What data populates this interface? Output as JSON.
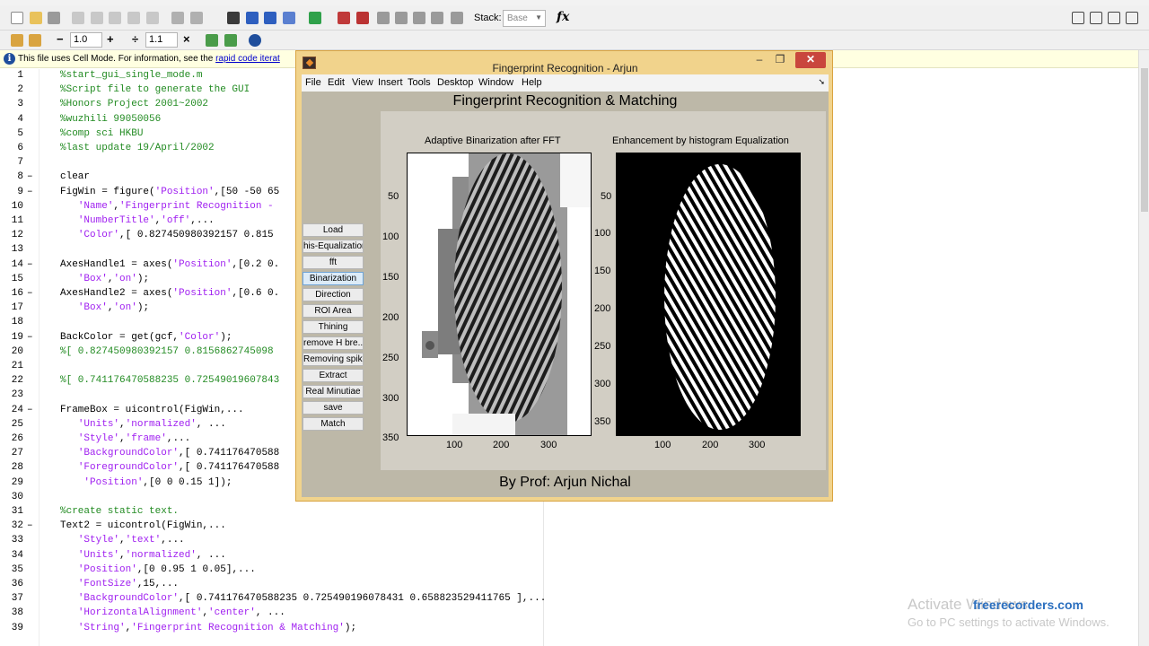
{
  "toolbar": {
    "stack_label": "Stack:",
    "stack_value": "Base",
    "fx_label": "fx"
  },
  "toolbar2": {
    "minus": "−",
    "field1": "1.0",
    "plus": "+",
    "divide": "÷",
    "field2": "1.1",
    "times": "×"
  },
  "infobar": {
    "text_before": "This file uses Cell Mode. For information, see the ",
    "link_text": "rapid code iterat"
  },
  "editor": {
    "lines": [
      {
        "n": "1",
        "fold": "",
        "code": [
          {
            "t": "%start_gui_single_mode.m",
            "c": "cm"
          }
        ]
      },
      {
        "n": "2",
        "fold": "",
        "code": [
          {
            "t": "%Script file to generate the GUI",
            "c": "cm"
          }
        ]
      },
      {
        "n": "3",
        "fold": "",
        "code": [
          {
            "t": "%Honors Project 2001~2002",
            "c": "cm"
          }
        ]
      },
      {
        "n": "4",
        "fold": "",
        "code": [
          {
            "t": "%wuzhili 99050056",
            "c": "cm"
          }
        ]
      },
      {
        "n": "5",
        "fold": "",
        "code": [
          {
            "t": "%comp sci HKBU",
            "c": "cm"
          }
        ]
      },
      {
        "n": "6",
        "fold": "",
        "code": [
          {
            "t": "%last update 19/April/2002",
            "c": "cm"
          }
        ]
      },
      {
        "n": "7",
        "fold": "",
        "code": []
      },
      {
        "n": "8",
        "fold": "–",
        "code": [
          {
            "t": "clear",
            "c": "txt"
          }
        ]
      },
      {
        "n": "9",
        "fold": "–",
        "code": [
          {
            "t": "FigWin = figure(",
            "c": "txt"
          },
          {
            "t": "'Position'",
            "c": "str"
          },
          {
            "t": ",[50 -50 65",
            "c": "txt"
          }
        ]
      },
      {
        "n": "10",
        "fold": "",
        "code": [
          {
            "t": "   ",
            "c": "txt"
          },
          {
            "t": "'Name'",
            "c": "str"
          },
          {
            "t": ",",
            "c": "txt"
          },
          {
            "t": "'Fingerprint Recognition -",
            "c": "str"
          }
        ]
      },
      {
        "n": "11",
        "fold": "",
        "code": [
          {
            "t": "   ",
            "c": "txt"
          },
          {
            "t": "'NumberTitle'",
            "c": "str"
          },
          {
            "t": ",",
            "c": "txt"
          },
          {
            "t": "'off'",
            "c": "str"
          },
          {
            "t": ",...",
            "c": "txt"
          }
        ]
      },
      {
        "n": "12",
        "fold": "",
        "code": [
          {
            "t": "   ",
            "c": "txt"
          },
          {
            "t": "'Color'",
            "c": "str"
          },
          {
            "t": ",[ 0.827450980392157 0.815",
            "c": "txt"
          }
        ]
      },
      {
        "n": "13",
        "fold": "",
        "code": []
      },
      {
        "n": "14",
        "fold": "–",
        "code": [
          {
            "t": "AxesHandle1 = axes(",
            "c": "txt"
          },
          {
            "t": "'Position'",
            "c": "str"
          },
          {
            "t": ",[0.2 0.",
            "c": "txt"
          }
        ]
      },
      {
        "n": "15",
        "fold": "",
        "code": [
          {
            "t": "   ",
            "c": "txt"
          },
          {
            "t": "'Box'",
            "c": "str"
          },
          {
            "t": ",",
            "c": "txt"
          },
          {
            "t": "'on'",
            "c": "str"
          },
          {
            "t": ");",
            "c": "txt"
          }
        ]
      },
      {
        "n": "16",
        "fold": "–",
        "code": [
          {
            "t": "AxesHandle2 = axes(",
            "c": "txt"
          },
          {
            "t": "'Position'",
            "c": "str"
          },
          {
            "t": ",[0.6 0.",
            "c": "txt"
          }
        ]
      },
      {
        "n": "17",
        "fold": "",
        "code": [
          {
            "t": "   ",
            "c": "txt"
          },
          {
            "t": "'Box'",
            "c": "str"
          },
          {
            "t": ",",
            "c": "txt"
          },
          {
            "t": "'on'",
            "c": "str"
          },
          {
            "t": ");",
            "c": "txt"
          }
        ]
      },
      {
        "n": "18",
        "fold": "",
        "code": []
      },
      {
        "n": "19",
        "fold": "–",
        "code": [
          {
            "t": "BackColor = get(gcf,",
            "c": "txt"
          },
          {
            "t": "'Color'",
            "c": "str"
          },
          {
            "t": ");",
            "c": "txt"
          }
        ]
      },
      {
        "n": "20",
        "fold": "",
        "code": [
          {
            "t": "%[ 0.827450980392157 0.8156862745098",
            "c": "cm"
          }
        ]
      },
      {
        "n": "21",
        "fold": "",
        "code": []
      },
      {
        "n": "22",
        "fold": "",
        "code": [
          {
            "t": "%[ 0.741176470588235 0.72549019607843",
            "c": "cm"
          }
        ]
      },
      {
        "n": "23",
        "fold": "",
        "code": []
      },
      {
        "n": "24",
        "fold": "–",
        "code": [
          {
            "t": "FrameBox = uicontrol(FigWin,...",
            "c": "txt"
          }
        ]
      },
      {
        "n": "25",
        "fold": "",
        "code": [
          {
            "t": "   ",
            "c": "txt"
          },
          {
            "t": "'Units'",
            "c": "str"
          },
          {
            "t": ",",
            "c": "txt"
          },
          {
            "t": "'normalized'",
            "c": "str"
          },
          {
            "t": ", ...",
            "c": "txt"
          }
        ]
      },
      {
        "n": "26",
        "fold": "",
        "code": [
          {
            "t": "   ",
            "c": "txt"
          },
          {
            "t": "'Style'",
            "c": "str"
          },
          {
            "t": ",",
            "c": "txt"
          },
          {
            "t": "'frame'",
            "c": "str"
          },
          {
            "t": ",...",
            "c": "txt"
          }
        ]
      },
      {
        "n": "27",
        "fold": "",
        "code": [
          {
            "t": "   ",
            "c": "txt"
          },
          {
            "t": "'BackgroundColor'",
            "c": "str"
          },
          {
            "t": ",[ 0.741176470588",
            "c": "txt"
          }
        ]
      },
      {
        "n": "28",
        "fold": "",
        "code": [
          {
            "t": "   ",
            "c": "txt"
          },
          {
            "t": "'ForegroundColor'",
            "c": "str"
          },
          {
            "t": ",[ 0.741176470588",
            "c": "txt"
          }
        ]
      },
      {
        "n": "29",
        "fold": "",
        "code": [
          {
            "t": "    ",
            "c": "txt"
          },
          {
            "t": "'Position'",
            "c": "str"
          },
          {
            "t": ",[0 0 0.15 1]);",
            "c": "txt"
          }
        ]
      },
      {
        "n": "30",
        "fold": "",
        "code": []
      },
      {
        "n": "31",
        "fold": "",
        "code": [
          {
            "t": "%create static text.",
            "c": "cm"
          }
        ]
      },
      {
        "n": "32",
        "fold": "–",
        "code": [
          {
            "t": "Text2 = uicontrol(FigWin,...",
            "c": "txt"
          }
        ]
      },
      {
        "n": "33",
        "fold": "",
        "code": [
          {
            "t": "   ",
            "c": "txt"
          },
          {
            "t": "'Style'",
            "c": "str"
          },
          {
            "t": ",",
            "c": "txt"
          },
          {
            "t": "'text'",
            "c": "str"
          },
          {
            "t": ",...",
            "c": "txt"
          }
        ]
      },
      {
        "n": "34",
        "fold": "",
        "code": [
          {
            "t": "   ",
            "c": "txt"
          },
          {
            "t": "'Units'",
            "c": "str"
          },
          {
            "t": ",",
            "c": "txt"
          },
          {
            "t": "'normalized'",
            "c": "str"
          },
          {
            "t": ", ...",
            "c": "txt"
          }
        ]
      },
      {
        "n": "35",
        "fold": "",
        "code": [
          {
            "t": "   ",
            "c": "txt"
          },
          {
            "t": "'Position'",
            "c": "str"
          },
          {
            "t": ",[0 0.95 1 0.05],...",
            "c": "txt"
          }
        ]
      },
      {
        "n": "36",
        "fold": "",
        "code": [
          {
            "t": "   ",
            "c": "txt"
          },
          {
            "t": "'FontSize'",
            "c": "str"
          },
          {
            "t": ",15,...",
            "c": "txt"
          }
        ]
      },
      {
        "n": "37",
        "fold": "",
        "code": [
          {
            "t": "   ",
            "c": "txt"
          },
          {
            "t": "'BackgroundColor'",
            "c": "str"
          },
          {
            "t": ",[ 0.741176470588235 0.725490196078431 0.658823529411765 ],...",
            "c": "txt"
          }
        ]
      },
      {
        "n": "38",
        "fold": "",
        "code": [
          {
            "t": "   ",
            "c": "txt"
          },
          {
            "t": "'HorizontalAlignment'",
            "c": "str"
          },
          {
            "t": ",",
            "c": "txt"
          },
          {
            "t": "'center'",
            "c": "str"
          },
          {
            "t": ", ...",
            "c": "txt"
          }
        ]
      },
      {
        "n": "39",
        "fold": "",
        "code": [
          {
            "t": "   ",
            "c": "txt"
          },
          {
            "t": "'String'",
            "c": "str"
          },
          {
            "t": ",",
            "c": "txt"
          },
          {
            "t": "'Fingerprint Recognition & Matching'",
            "c": "str"
          },
          {
            "t": ");",
            "c": "txt"
          }
        ]
      }
    ]
  },
  "figure": {
    "title": "Fingerprint Recognition - Arjun",
    "menus": [
      "File",
      "Edit",
      "View",
      "Insert",
      "Tools",
      "Desktop",
      "Window",
      "Help"
    ],
    "gui_title": "Fingerprint Recognition & Matching",
    "footer": "By Prof: Arjun Nichal",
    "buttons": [
      "Load",
      "his-Equalization",
      "fft",
      "Binarization",
      "Direction",
      "ROI Area",
      "Thining",
      "remove H bre...",
      "Removing spike",
      "Extract",
      "Real Minutiae",
      "save",
      "Match"
    ],
    "active_button": "Binarization",
    "axes1": {
      "title": "Adaptive Binarization after FFT",
      "yticks": [
        "50",
        "100",
        "150",
        "200",
        "250",
        "300",
        "350"
      ],
      "xticks": [
        "100",
        "200",
        "300"
      ]
    },
    "axes2": {
      "title": "Enhancement by histogram Equalization",
      "yticks": [
        "50",
        "100",
        "150",
        "200",
        "250",
        "300",
        "350"
      ],
      "xticks": [
        "100",
        "200",
        "300"
      ]
    }
  },
  "watermark": {
    "line1": "Activate Windows",
    "line2": "Go to PC settings to activate Windows.",
    "recorder": "freerecorders.com"
  },
  "colors": {
    "comment": "#228b22",
    "string": "#a020f0",
    "figure_border": "#f1d38c",
    "figure_bg": "#bdb8a8"
  }
}
